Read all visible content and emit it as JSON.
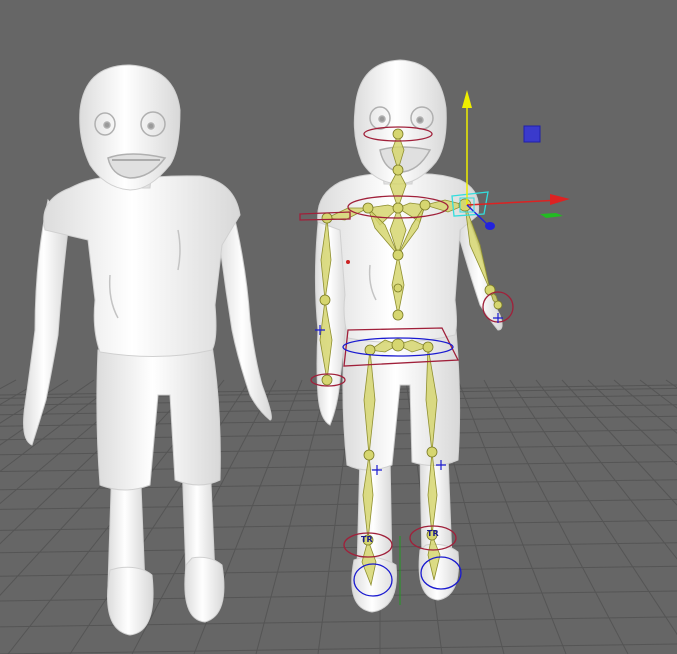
{
  "viewport": {
    "background": "#666666",
    "grid_color": "#555555",
    "mesh_color": "#f4f4f4",
    "bone_color": "#c8c85a",
    "control_red": "#a0203a",
    "control_blue": "#1a1ad0"
  },
  "characters": [
    {
      "name": "zombie-mesh-unrigged",
      "rigged": false
    },
    {
      "name": "zombie-mesh-rigged",
      "rigged": true
    }
  ],
  "controls": {
    "left_foot_label": "TR",
    "right_foot_label": "TR"
  },
  "icons": {
    "gizmo": "move-gizmo-icon",
    "view_cube": "view-cube-icon"
  }
}
